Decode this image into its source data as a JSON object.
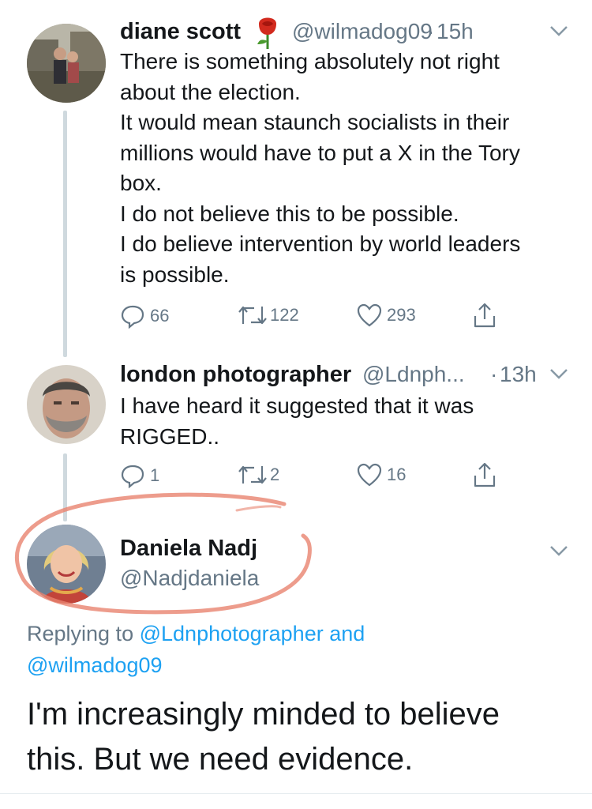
{
  "tweets": [
    {
      "name": "diane scott",
      "name_emoji": "rose-emoji",
      "handle": "@wilmadog09",
      "dot": "·",
      "time": "15h",
      "lines": [
        "There is something absolutely not right",
        "about the election.",
        "It would mean staunch socialists in their",
        "millions would have to put a X in the Tory",
        "box.",
        "I do not believe this to be possible.",
        "I do believe intervention by world leaders",
        "is possible."
      ],
      "replies": "66",
      "retweets": "122",
      "likes": "293"
    },
    {
      "name": "london photographer",
      "handle": "@Ldnph...",
      "dot": "·",
      "time": "13h",
      "lines": [
        "I have heard it suggested that it was",
        "RIGGED.."
      ],
      "replies": "1",
      "retweets": "2",
      "likes": "16"
    }
  ],
  "focused": {
    "name": "Daniela Nadj",
    "handle": "@Nadjdaniela",
    "replying_prefix": "Replying to",
    "reply_to_1": "@Ldnphotographer",
    "reply_and": "and",
    "reply_to_2": "@wilmadog09",
    "lines": [
      "I'm increasingly minded to believe",
      "this. But we need evidence."
    ]
  },
  "colors": {
    "text": "#14171a",
    "muted": "#657786",
    "link": "#1da1f2",
    "thread_line": "#cfd9de",
    "annotation": "#e8836f"
  },
  "icons": [
    "reply-icon",
    "retweet-icon",
    "like-icon",
    "share-icon",
    "chevron-down-icon"
  ]
}
